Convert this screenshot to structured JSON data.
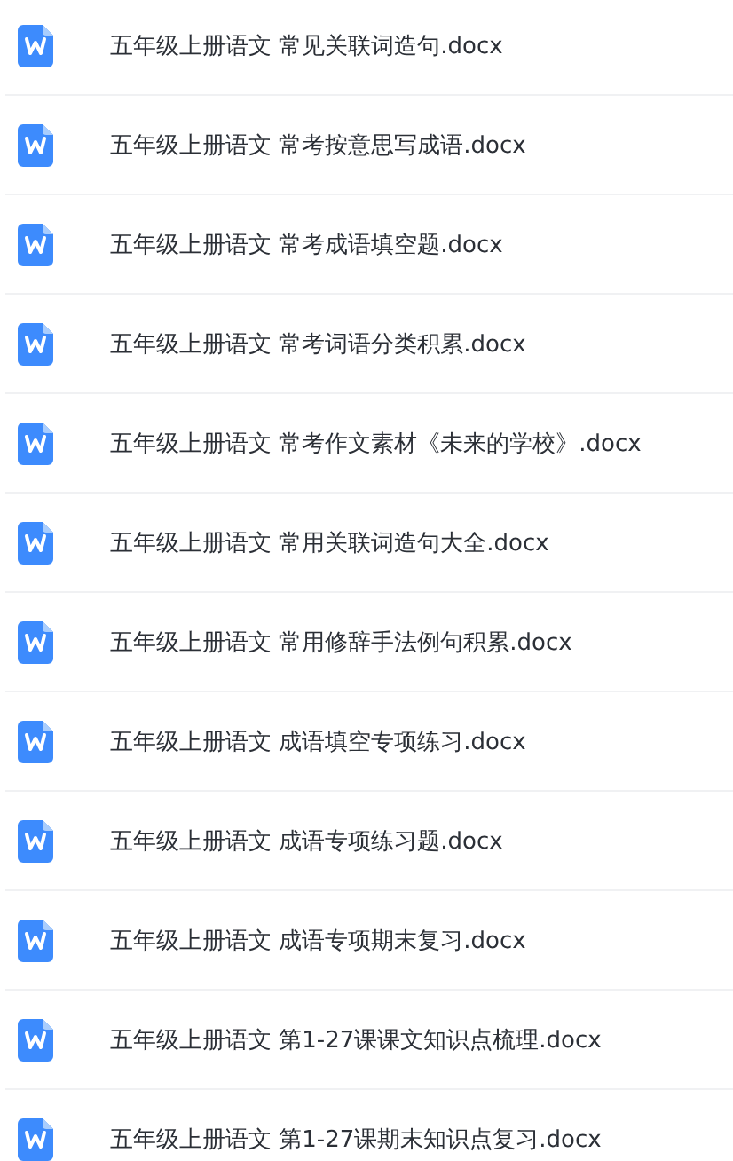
{
  "files": [
    {
      "name": "五年级上册语文 常见关联词造句.docx"
    },
    {
      "name": "五年级上册语文 常考按意思写成语.docx"
    },
    {
      "name": "五年级上册语文 常考成语填空题.docx"
    },
    {
      "name": "五年级上册语文 常考词语分类积累.docx"
    },
    {
      "name": "五年级上册语文 常考作文素材《未来的学校》.docx"
    },
    {
      "name": "五年级上册语文 常用关联词造句大全.docx"
    },
    {
      "name": "五年级上册语文 常用修辞手法例句积累.docx"
    },
    {
      "name": "五年级上册语文 成语填空专项练习.docx"
    },
    {
      "name": "五年级上册语文 成语专项练习题.docx"
    },
    {
      "name": "五年级上册语文 成语专项期末复习.docx"
    },
    {
      "name": "五年级上册语文 第1-27课课文知识点梳理.docx"
    },
    {
      "name": "五年级上册语文 第1-27课期末知识点复习.docx"
    }
  ]
}
